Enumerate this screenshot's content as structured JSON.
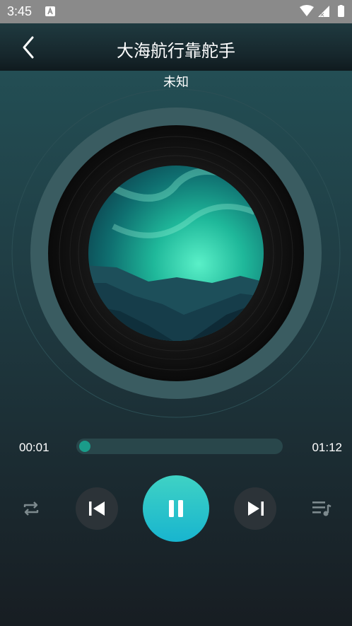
{
  "status_bar": {
    "time": "3:45"
  },
  "header": {
    "title": "大海航行靠舵手"
  },
  "song": {
    "artist": "未知"
  },
  "progress": {
    "current": "00:01",
    "total": "01:12",
    "fraction": 0.014
  },
  "colors": {
    "accent": "#1fc3c9",
    "progress_thumb": "#1a9c8a",
    "track": "#29474b"
  },
  "icons": {
    "back": "chevron-left-icon",
    "repeat": "repeat-icon",
    "previous": "skip-previous-icon",
    "play_pause": "pause-icon",
    "next": "skip-next-icon",
    "playlist": "playlist-icon"
  }
}
